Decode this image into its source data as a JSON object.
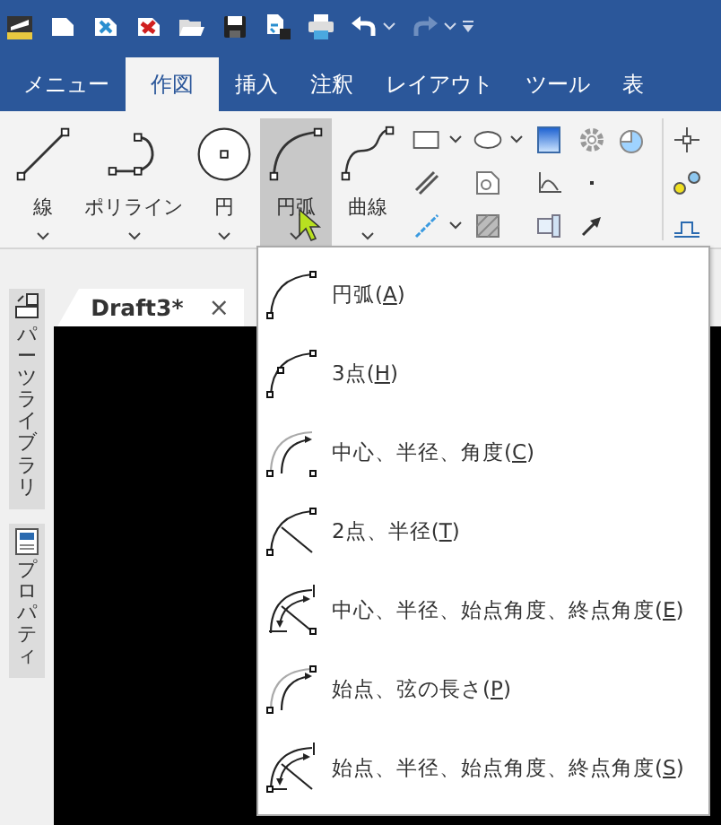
{
  "quick_access": {
    "redo": {
      "disabled": true
    }
  },
  "tabs": [
    {
      "label": "メニュー",
      "selected": false
    },
    {
      "label": "作図",
      "selected": true
    },
    {
      "label": "挿入",
      "selected": false
    },
    {
      "label": "注釈",
      "selected": false
    },
    {
      "label": "レイアウト",
      "selected": false
    },
    {
      "label": "ツール",
      "selected": false
    },
    {
      "label": "表",
      "selected": false
    }
  ],
  "ribbon": {
    "buttons": [
      {
        "label": "線",
        "pressed": false
      },
      {
        "label": "ポリライン",
        "pressed": false
      },
      {
        "label": "円",
        "pressed": false
      },
      {
        "label": "円弧",
        "pressed": true
      },
      {
        "label": "曲線",
        "pressed": false
      }
    ]
  },
  "sidebar": {
    "panels": [
      {
        "label": "パーツライブラリ"
      },
      {
        "label": "プロパティ"
      }
    ]
  },
  "document_tab": {
    "title": "Draft3*",
    "close": "×"
  },
  "menu": {
    "items": [
      {
        "text": "円弧(",
        "accelerator": "A",
        "after": ")"
      },
      {
        "text": "3点(",
        "accelerator": "H",
        "after": ")"
      },
      {
        "text": "中心、半径、角度(",
        "accelerator": "C",
        "after": ")"
      },
      {
        "text": "2点、半径(",
        "accelerator": "T",
        "after": ")"
      },
      {
        "text": "中心、半径、始点角度、終点角度(",
        "accelerator": "E",
        "after": ")"
      },
      {
        "text": "始点、弦の長さ(",
        "accelerator": "P",
        "after": ")"
      },
      {
        "text": "始点、半径、始点角度、終点角度(",
        "accelerator": "S",
        "after": ")"
      }
    ]
  }
}
